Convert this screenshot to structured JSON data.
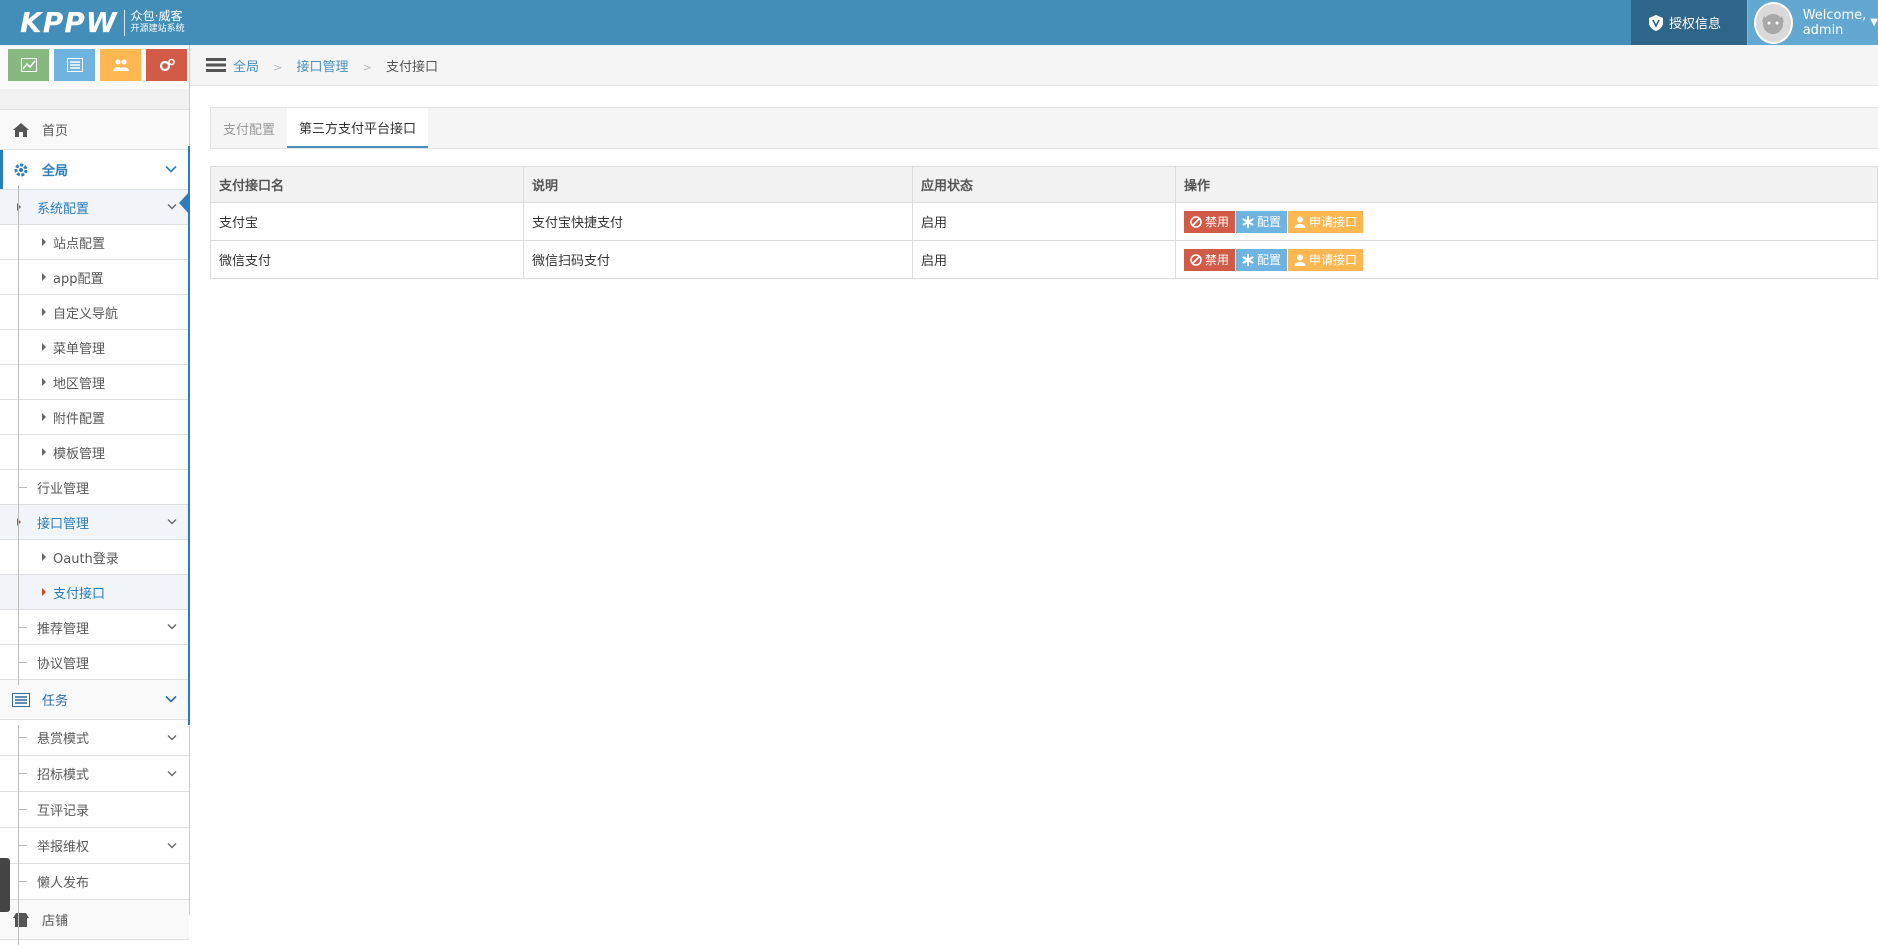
{
  "header": {
    "brand": "KPPW",
    "brand_line1": "众包·威客",
    "brand_line2": "开源建站系统",
    "license_label": "授权信息",
    "welcome": "Welcome,",
    "username": "admin"
  },
  "breadcrumb": {
    "items": [
      "全局",
      "接口管理"
    ],
    "current": "支付接口"
  },
  "tabs": [
    "支付配置",
    "第三方支付平台接口"
  ],
  "sidebar": {
    "home": "首页",
    "global": "全局",
    "system_config": "系统配置",
    "system_children": [
      "站点配置",
      "app配置",
      "自定义导航",
      "菜单管理",
      "地区管理",
      "附件配置",
      "模板管理"
    ],
    "industry": "行业管理",
    "interface": "接口管理",
    "interface_children": [
      "Oauth登录",
      "支付接口"
    ],
    "recommend": "推荐管理",
    "agreement": "协议管理",
    "task": "任务",
    "task_children": [
      "悬赏模式",
      "招标模式",
      "互评记录",
      "举报维权",
      "懒人发布"
    ],
    "shop": "店铺"
  },
  "table": {
    "columns": [
      "支付接口名",
      "说明",
      "应用状态",
      "操作"
    ],
    "rows": [
      {
        "name": "支付宝",
        "desc": "支付宝快捷支付",
        "status": "启用"
      },
      {
        "name": "微信支付",
        "desc": "微信扫码支付",
        "status": "启用"
      }
    ],
    "actions": {
      "disable": "禁用",
      "config": "配置",
      "apply": "申请接口"
    }
  },
  "colors": {
    "navbar": "#438eb9",
    "btn_danger": "#d15b47",
    "btn_info": "#6fb3e0",
    "btn_warning": "#ffb752"
  }
}
